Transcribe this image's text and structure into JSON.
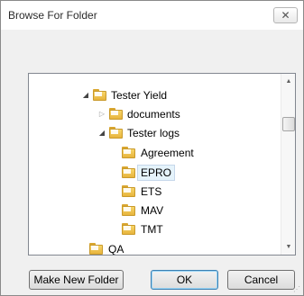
{
  "window": {
    "title": "Browse For Folder",
    "close_glyph": "✕"
  },
  "tree": {
    "items": [
      {
        "label": "Tester Yield",
        "expander": "expanded",
        "selected": false
      },
      {
        "label": "documents",
        "expander": "collapsed",
        "selected": false
      },
      {
        "label": "Tester logs",
        "expander": "expanded",
        "selected": false
      },
      {
        "label": "Agreement",
        "expander": "none",
        "selected": false
      },
      {
        "label": "EPRO",
        "expander": "none",
        "selected": true
      },
      {
        "label": "ETS",
        "expander": "none",
        "selected": false
      },
      {
        "label": "MAV",
        "expander": "none",
        "selected": false
      },
      {
        "label": "TMT",
        "expander": "none",
        "selected": false
      },
      {
        "label": "QA",
        "expander": "none",
        "selected": false
      }
    ],
    "expanded_glyph": "◢",
    "collapsed_glyph": "▷",
    "scroll_up_glyph": "▲",
    "scroll_down_glyph": "▼"
  },
  "buttons": {
    "make_new_folder": "Make New Folder",
    "ok": "OK",
    "cancel": "Cancel"
  },
  "icons": {
    "folder": "folder-icon",
    "close": "close-icon",
    "resize_grip": "resize-grip-icon"
  }
}
